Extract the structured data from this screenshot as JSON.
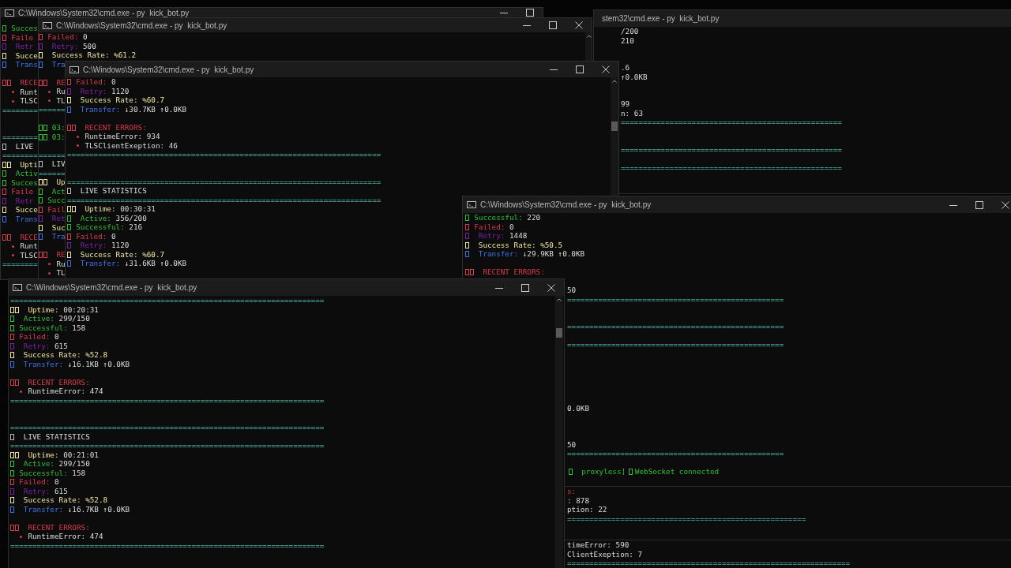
{
  "windows": [
    {
      "title": "C:\\Windows\\System32\\cmd.exe - py  kick_bot.py",
      "lines": [
        {
          "kind": "successful",
          "label": "Succes"
        },
        {
          "kind": "failed",
          "label": "Faile"
        },
        {
          "kind": "retry",
          "label": "Retr"
        },
        {
          "kind": "rate",
          "label": "Succe"
        },
        {
          "kind": "transfer",
          "label": "Trans"
        },
        {
          "kind": "blank"
        },
        {
          "kind": "errors",
          "label": "RECE"
        },
        {
          "kind": "error",
          "label": "Runt"
        },
        {
          "kind": "error",
          "label": "TLSC"
        },
        {
          "kind": "rule",
          "text": "========"
        },
        {
          "kind": "blank"
        },
        {
          "kind": "blank"
        },
        {
          "kind": "rule",
          "text": "========"
        },
        {
          "kind": "live",
          "label": "LIVE"
        },
        {
          "kind": "rule",
          "text": "========"
        },
        {
          "kind": "uptime",
          "label": "Upti"
        },
        {
          "kind": "active",
          "label": "Activ"
        },
        {
          "kind": "successful",
          "label": "Succes"
        },
        {
          "kind": "failed",
          "label": "Faile"
        },
        {
          "kind": "retry",
          "label": "Retr"
        },
        {
          "kind": "rate",
          "label": "Succe"
        },
        {
          "kind": "transfer",
          "label": "Trans"
        },
        {
          "kind": "blank"
        },
        {
          "kind": "errors",
          "label": "RECE"
        },
        {
          "kind": "error",
          "label": "Runt"
        },
        {
          "kind": "error",
          "label": "TLSC"
        },
        {
          "kind": "rule",
          "text": "========"
        }
      ]
    },
    {
      "title": "stem32\\cmd.exe - py  kick_bot.py",
      "lines": [
        {
          "kind": "tail",
          "text": "/200"
        },
        {
          "kind": "tail",
          "text": "210"
        },
        {
          "kind": "blank"
        },
        {
          "kind": "blank"
        },
        {
          "kind": "tail",
          "text": ".6"
        },
        {
          "kind": "tail",
          "text": "↑0.0KB"
        },
        {
          "kind": "blank"
        },
        {
          "kind": "blank"
        },
        {
          "kind": "tail",
          "text": "99"
        },
        {
          "kind": "tail",
          "text": "n: 63"
        },
        {
          "kind": "rule",
          "text": "=================================================="
        },
        {
          "kind": "blank"
        },
        {
          "kind": "blank"
        },
        {
          "kind": "rule",
          "text": "=================================================="
        },
        {
          "kind": "blank"
        },
        {
          "kind": "rule",
          "text": "=================================================="
        }
      ]
    },
    {
      "title": "C:\\Windows\\System32\\cmd.exe - py  kick_bot.py",
      "lines": [
        {
          "kind": "failed",
          "label": "Failed:",
          "value": "0"
        },
        {
          "kind": "retry",
          "label": "Retry:",
          "value": "500"
        },
        {
          "kind": "rate",
          "label": "Success Rate:",
          "value": "%61.2"
        },
        {
          "kind": "transfer",
          "label": "Tra"
        },
        {
          "kind": "blank"
        },
        {
          "kind": "errors",
          "label": "RE"
        },
        {
          "kind": "error",
          "label": "Ru"
        },
        {
          "kind": "error",
          "label": "TL"
        },
        {
          "kind": "rule",
          "text": "======"
        },
        {
          "kind": "blank"
        },
        {
          "kind": "log",
          "label": "03:"
        },
        {
          "kind": "log",
          "label": "03:"
        },
        {
          "kind": "blank"
        },
        {
          "kind": "rule",
          "text": "======"
        },
        {
          "kind": "live",
          "label": "LIV"
        },
        {
          "kind": "rule",
          "text": "======"
        },
        {
          "kind": "uptime",
          "label": "Up"
        },
        {
          "kind": "active",
          "label": "Act"
        },
        {
          "kind": "successful",
          "label": "Succ"
        },
        {
          "kind": "failed",
          "label": "Fail"
        },
        {
          "kind": "retry",
          "label": "Ret"
        },
        {
          "kind": "rate",
          "label": "Suc"
        },
        {
          "kind": "transfer",
          "label": "Tra"
        },
        {
          "kind": "blank"
        },
        {
          "kind": "errors",
          "label": "RE"
        },
        {
          "kind": "error",
          "label": "Ru"
        },
        {
          "kind": "error",
          "label": "TL"
        }
      ]
    },
    {
      "title": "C:\\Windows\\System32\\cmd.exe - py  kick_bot.py",
      "lines": [
        {
          "kind": "failed",
          "label": "Failed:",
          "value": "0"
        },
        {
          "kind": "retry",
          "label": "Retry:",
          "value": "1120"
        },
        {
          "kind": "rate",
          "label": "Success Rate:",
          "value": "%60.7"
        },
        {
          "kind": "transfer",
          "label": "Transfer:",
          "value": "↓30.7KB ↑0.0KB"
        },
        {
          "kind": "blank"
        },
        {
          "kind": "errors",
          "label": "RECENT ERRORS:"
        },
        {
          "kind": "error",
          "label": "RuntimeError:",
          "value": "934"
        },
        {
          "kind": "error",
          "label": "TLSClientExeption:",
          "value": "46"
        },
        {
          "kind": "rule",
          "text": "======================================================================="
        },
        {
          "kind": "blank"
        },
        {
          "kind": "blank"
        },
        {
          "kind": "rule",
          "text": "======================================================================="
        },
        {
          "kind": "live",
          "label": "LIVE STATISTICS"
        },
        {
          "kind": "rule",
          "text": "======================================================================="
        },
        {
          "kind": "uptime",
          "label": "Uptime:",
          "value": "00:30:31"
        },
        {
          "kind": "active",
          "label": "Active:",
          "value": "356/200"
        },
        {
          "kind": "successful",
          "label": "Successful:",
          "value": "216"
        },
        {
          "kind": "failed",
          "label": "Failed:",
          "value": "0"
        },
        {
          "kind": "retry",
          "label": "Retry:",
          "value": "1120"
        },
        {
          "kind": "rate",
          "label": "Success Rate:",
          "value": "%60.7"
        },
        {
          "kind": "transfer",
          "label": "Transfer:",
          "value": "↓31.6KB ↑0.0KB"
        }
      ]
    },
    {
      "title": "C:\\Windows\\System32\\cmd.exe - py  kick_bot.py",
      "lines": [
        {
          "kind": "successful",
          "label": "Successful:",
          "value": "220"
        },
        {
          "kind": "failed",
          "label": "Failed:",
          "value": "0"
        },
        {
          "kind": "retry",
          "label": "Retry:",
          "value": "1448"
        },
        {
          "kind": "rate",
          "label": "Success Rate:",
          "value": "%50.5"
        },
        {
          "kind": "transfer",
          "label": "Transfer:",
          "value": "↓29.9KB ↑0.0KB"
        },
        {
          "kind": "blank"
        },
        {
          "kind": "errors",
          "label": "RECENT ERRORS:"
        },
        {
          "kind": "blank"
        },
        {
          "kind": "tail",
          "text": "50"
        },
        {
          "kind": "rule",
          "text": "================================================="
        },
        {
          "kind": "blank"
        },
        {
          "kind": "blank"
        },
        {
          "kind": "rule",
          "text": "================================================="
        },
        {
          "kind": "blank"
        },
        {
          "kind": "rule",
          "text": "================================================="
        },
        {
          "kind": "blank"
        },
        {
          "kind": "blank"
        },
        {
          "kind": "blank"
        },
        {
          "kind": "blank"
        },
        {
          "kind": "blank"
        },
        {
          "kind": "blank"
        },
        {
          "kind": "tail",
          "text": "0.0KB"
        },
        {
          "kind": "blank"
        },
        {
          "kind": "blank"
        },
        {
          "kind": "blank"
        },
        {
          "kind": "tail",
          "text": "50"
        },
        {
          "kind": "rule",
          "text": "================================================="
        },
        {
          "kind": "blank"
        },
        {
          "kind": "ws-tail",
          "label": "proxyless]",
          "value": "WebSocket connected"
        }
      ]
    },
    {
      "lines": [
        {
          "kind": "errors-tail",
          "text": "s:"
        },
        {
          "kind": "tail",
          "text": ": 878"
        },
        {
          "kind": "tail",
          "text": "ption: 22"
        },
        {
          "kind": "rule",
          "text": "======================================================"
        }
      ]
    },
    {
      "lines": [
        {
          "kind": "tail",
          "text": "timeError: 590"
        },
        {
          "kind": "tail",
          "text": "ClientExeption: 7"
        },
        {
          "kind": "rule",
          "text": "================================================================"
        }
      ]
    },
    {
      "title": "C:\\Windows\\System32\\cmd.exe - py  kick_bot.py",
      "lines": [
        {
          "kind": "rule",
          "text": "======================================================================="
        },
        {
          "kind": "uptime",
          "label": "Uptime:",
          "value": "00:20:31"
        },
        {
          "kind": "active",
          "label": "Active:",
          "value": "299/150"
        },
        {
          "kind": "successful",
          "label": "Successful:",
          "value": "158"
        },
        {
          "kind": "failed",
          "label": "Failed:",
          "value": "0"
        },
        {
          "kind": "retry",
          "label": "Retry:",
          "value": "615"
        },
        {
          "kind": "rate",
          "label": "Success Rate:",
          "value": "%52.8"
        },
        {
          "kind": "transfer",
          "label": "Transfer:",
          "value": "↓16.1KB ↑0.0KB"
        },
        {
          "kind": "blank"
        },
        {
          "kind": "errors",
          "label": "RECENT ERRORS:"
        },
        {
          "kind": "error",
          "label": "RuntimeError:",
          "value": "474"
        },
        {
          "kind": "rule",
          "text": "======================================================================="
        },
        {
          "kind": "blank"
        },
        {
          "kind": "blank"
        },
        {
          "kind": "rule",
          "text": "======================================================================="
        },
        {
          "kind": "live",
          "label": "LIVE STATISTICS"
        },
        {
          "kind": "rule",
          "text": "======================================================================="
        },
        {
          "kind": "uptime",
          "label": "Uptime:",
          "value": "00:21:01"
        },
        {
          "kind": "active",
          "label": "Active:",
          "value": "299/150"
        },
        {
          "kind": "successful",
          "label": "Successful:",
          "value": "158"
        },
        {
          "kind": "failed",
          "label": "Failed:",
          "value": "0"
        },
        {
          "kind": "retry",
          "label": "Retry:",
          "value": "615"
        },
        {
          "kind": "rate",
          "label": "Success Rate:",
          "value": "%52.8"
        },
        {
          "kind": "transfer",
          "label": "Transfer:",
          "value": "↓16.7KB ↑0.0KB"
        },
        {
          "kind": "blank"
        },
        {
          "kind": "errors",
          "label": "RECENT ERRORS:"
        },
        {
          "kind": "error",
          "label": "RuntimeError:",
          "value": "474"
        },
        {
          "kind": "rule",
          "text": "======================================================================="
        }
      ]
    }
  ]
}
